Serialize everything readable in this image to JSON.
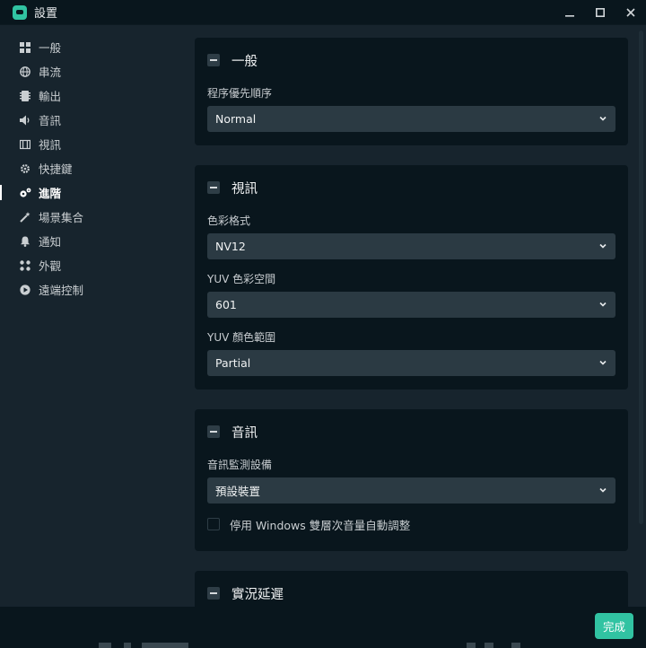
{
  "window": {
    "title": "設置"
  },
  "sidebar": {
    "items": [
      {
        "label": "一般",
        "icon": "grid-icon"
      },
      {
        "label": "串流",
        "icon": "globe-icon"
      },
      {
        "label": "輸出",
        "icon": "output-icon"
      },
      {
        "label": "音訊",
        "icon": "speaker-icon"
      },
      {
        "label": "視訊",
        "icon": "film-icon"
      },
      {
        "label": "快捷鍵",
        "icon": "gear-icon"
      },
      {
        "label": "進階",
        "icon": "cogs-icon",
        "active": true
      },
      {
        "label": "場景集合",
        "icon": "magic-wand-icon"
      },
      {
        "label": "通知",
        "icon": "bell-icon"
      },
      {
        "label": "外觀",
        "icon": "palette-icon"
      },
      {
        "label": "遠端控制",
        "icon": "play-circle-icon"
      }
    ]
  },
  "sections": {
    "general": {
      "title": "一般",
      "priority_label": "程序優先順序",
      "priority_value": "Normal"
    },
    "video": {
      "title": "視訊",
      "color_format_label": "色彩格式",
      "color_format_value": "NV12",
      "yuv_space_label": "YUV 色彩空間",
      "yuv_space_value": "601",
      "yuv_range_label": "YUV 顏色範圍",
      "yuv_range_value": "Partial"
    },
    "audio": {
      "title": "音訊",
      "monitor_label": "音訊監測設備",
      "monitor_value": "預設裝置",
      "ducking_label": "停用 Windows 雙層次音量自動調整",
      "ducking_checked": false
    },
    "delay": {
      "title": "實況延遲"
    }
  },
  "footer": {
    "done_label": "完成"
  },
  "colors": {
    "accent": "#31c3a2",
    "panel": "#09161d",
    "background": "#17242d",
    "input": "#2b3a43"
  }
}
